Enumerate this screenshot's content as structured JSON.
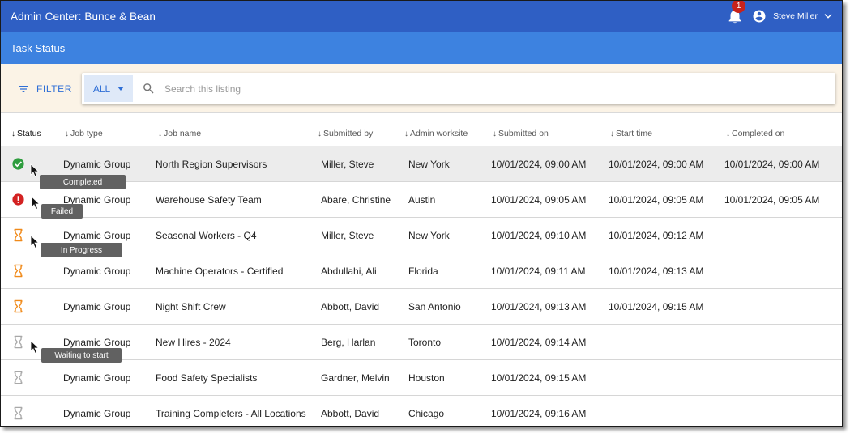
{
  "app": {
    "title": "Admin Center: Bunce & Bean",
    "notifications_count": "1",
    "user_name": "Steve Miller"
  },
  "page": {
    "title": "Task Status"
  },
  "filter": {
    "button_label": "FILTER",
    "scope": "ALL",
    "search_placeholder": "Search this listing",
    "search_value": ""
  },
  "table": {
    "columns": {
      "status": "Status",
      "job_type": "Job type",
      "job_name": "Job name",
      "submitted_by": "Submitted by",
      "worksite": "Admin worksite",
      "submitted_on": "Submitted on",
      "start_time": "Start time",
      "completed_on": "Completed on"
    },
    "rows": [
      {
        "status": "completed",
        "job_type": "Dynamic Group",
        "job_name": "North Region Supervisors",
        "submitted_by": "Miller, Steve",
        "worksite": "New York",
        "submitted_on": "10/01/2024, 09:00 AM",
        "start_time": "10/01/2024, 09:00 AM",
        "completed_on": "10/01/2024, 09:00 AM"
      },
      {
        "status": "failed",
        "job_type": "Dynamic Group",
        "job_name": "Warehouse Safety Team",
        "submitted_by": "Abare, Christine",
        "worksite": "Austin",
        "submitted_on": "10/01/2024, 09:05 AM",
        "start_time": "10/01/2024, 09:05 AM",
        "completed_on": "10/01/2024, 09:05 AM"
      },
      {
        "status": "in-progress",
        "job_type": "Dynamic Group",
        "job_name": "Seasonal Workers - Q4",
        "submitted_by": "Miller, Steve",
        "worksite": "New York",
        "submitted_on": "10/01/2024, 09:10 AM",
        "start_time": "10/01/2024, 09:12 AM",
        "completed_on": ""
      },
      {
        "status": "in-progress",
        "job_type": "Dynamic Group",
        "job_name": "Machine Operators - Certified",
        "submitted_by": "Abdullahi, Ali",
        "worksite": "Florida",
        "submitted_on": "10/01/2024, 09:11 AM",
        "start_time": "10/01/2024, 09:13 AM",
        "completed_on": ""
      },
      {
        "status": "in-progress",
        "job_type": "Dynamic Group",
        "job_name": "Night Shift Crew",
        "submitted_by": "Abbott, David",
        "worksite": "San Antonio",
        "submitted_on": "10/01/2024, 09:13 AM",
        "start_time": "10/01/2024, 09:15 AM",
        "completed_on": ""
      },
      {
        "status": "waiting",
        "job_type": "Dynamic Group",
        "job_name": "New Hires - 2024",
        "submitted_by": "Berg, Harlan",
        "worksite": "Toronto",
        "submitted_on": "10/01/2024, 09:14 AM",
        "start_time": "",
        "completed_on": ""
      },
      {
        "status": "waiting",
        "job_type": "Dynamic Group",
        "job_name": "Food Safety Specialists",
        "submitted_by": "Gardner, Melvin",
        "worksite": "Houston",
        "submitted_on": "10/01/2024, 09:15 AM",
        "start_time": "",
        "completed_on": ""
      },
      {
        "status": "waiting",
        "job_type": "Dynamic Group",
        "job_name": "Training Completers - All Locations",
        "submitted_by": "Abbott, David",
        "worksite": "Chicago",
        "submitted_on": "10/01/2024, 09:16 AM",
        "start_time": "",
        "completed_on": ""
      }
    ]
  },
  "tooltips": {
    "completed": "Completed",
    "failed": "Failed",
    "in_progress": "In Progress",
    "waiting": "Waiting to start"
  },
  "icons": {
    "notifications": "bell-icon",
    "user": "account-circle-icon",
    "menu": "chevron-down-icon",
    "filter": "filter-list-icon",
    "search": "search-icon",
    "completed": "check-circle-icon",
    "failed": "error-icon",
    "in_progress": "hourglass-icon",
    "waiting": "hourglass-empty-icon"
  },
  "colors": {
    "appbar": "#2f5fc4",
    "subbar": "#3d82e0",
    "filter_strip": "#fbf3e6",
    "accent": "#2f6fd6",
    "completed": "#2e9d3e",
    "failed": "#d32222",
    "in_progress": "#f08a1a",
    "waiting": "#a8a8a8",
    "badge": "#c8221b"
  }
}
